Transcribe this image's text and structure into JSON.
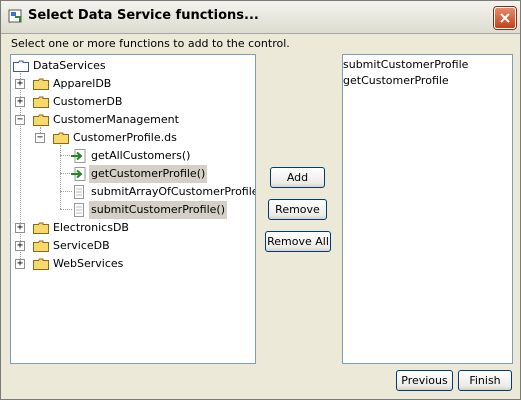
{
  "window": {
    "title": "Select Data Service functions..."
  },
  "prompt": "Select one or more functions to add to the control.",
  "tree": {
    "root": "DataServices",
    "nodes": [
      {
        "label": "ApparelDB",
        "expander": "+"
      },
      {
        "label": "CustomerDB",
        "expander": "+"
      },
      {
        "label": "CustomerManagement",
        "expander": "−"
      },
      {
        "label": "CustomerProfile.ds",
        "expander": "−"
      },
      {
        "label": "getAllCustomers()"
      },
      {
        "label": "getCustomerProfile()"
      },
      {
        "label": "submitArrayOfCustomerProfile()"
      },
      {
        "label": "submitCustomerProfile()"
      },
      {
        "label": "ElectronicsDB",
        "expander": "+"
      },
      {
        "label": "ServiceDB",
        "expander": "+"
      },
      {
        "label": "WebServices",
        "expander": "+"
      }
    ]
  },
  "buttons": {
    "add": "Add",
    "remove": "Remove",
    "remove_all": "Remove All",
    "previous": "Previous",
    "finish": "Finish"
  },
  "selected_functions": [
    "submitCustomerProfile",
    "getCustomerProfile"
  ],
  "colors": {
    "folder": "#f6d86b",
    "read_arrow": "#1e8a1e",
    "selection": "#d4d0c8",
    "close": "#c44119"
  }
}
